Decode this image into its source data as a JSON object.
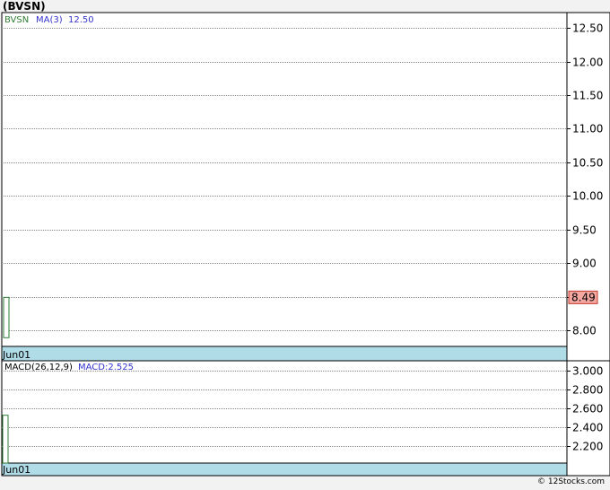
{
  "title": "(BVSN)",
  "footer": "© 12Stocks.com",
  "colors": {
    "price_legend": "#2e7d32",
    "ma_legend": "#3333cc",
    "macd_legend": "#3333cc",
    "candle": "#2e7d32",
    "price_tag_bg": "#f4a6a0",
    "price_tag_border": "#c0392b",
    "date_band": "#b0dce8"
  },
  "chart_data": [
    {
      "type": "candlestick",
      "panel": "price",
      "legend": {
        "ticker": "BVSN",
        "ma_label": "MA(3)",
        "ma_value": "12.50"
      },
      "ylim": [
        7.76,
        12.73
      ],
      "yticks": [
        8.0,
        8.5,
        9.0,
        9.5,
        10.0,
        10.5,
        11.0,
        11.5,
        12.0,
        12.5
      ],
      "ytick_labels": [
        "8.00",
        "8.50",
        "9.00",
        "9.50",
        "10.00",
        "10.50",
        "11.00",
        "11.50",
        "12.00",
        "12.50"
      ],
      "x_label": "Jun01",
      "grid": true,
      "candles": [
        {
          "date": "Jun01",
          "open": 8.49,
          "high": 8.49,
          "low": 7.89,
          "close": 7.89
        }
      ],
      "last_price": "8.49"
    },
    {
      "type": "bar",
      "panel": "macd",
      "legend": {
        "label": "MACD(26,12,9)",
        "value_label": "MACD:2.525"
      },
      "ylim": [
        2.02,
        3.1
      ],
      "yticks": [
        2.2,
        2.4,
        2.6,
        2.8,
        3.0
      ],
      "ytick_labels": [
        "2.200",
        "2.400",
        "2.600",
        "2.800",
        "3.000"
      ],
      "x_label": "Jun01",
      "grid": true,
      "bars": [
        {
          "date": "Jun01",
          "value": 2.525
        }
      ]
    }
  ]
}
